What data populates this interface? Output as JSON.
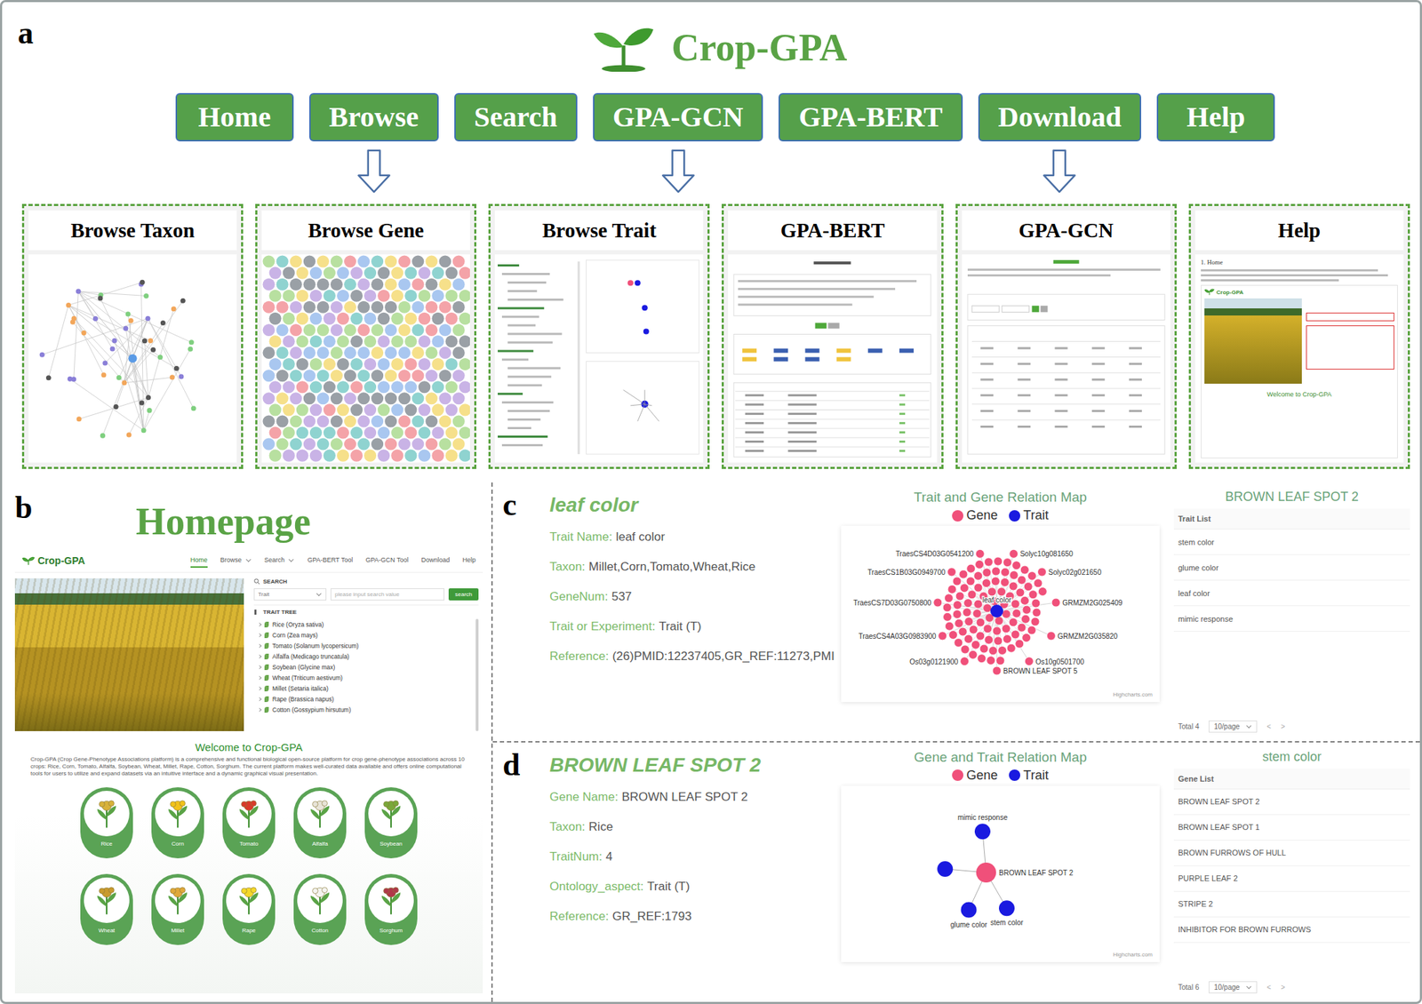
{
  "a": {
    "label": "a",
    "logo": "Crop-GPA",
    "nav": [
      {
        "label": "Home",
        "arrow": false
      },
      {
        "label": "Browse",
        "arrow": true
      },
      {
        "label": "Search",
        "arrow": false
      },
      {
        "label": "GPA-GCN",
        "arrow": true
      },
      {
        "label": "GPA-BERT",
        "arrow": false
      },
      {
        "label": "Download",
        "arrow": true
      },
      {
        "label": "Help",
        "arrow": false
      }
    ],
    "cards": [
      {
        "title": "Browse Taxon",
        "kind": "taxon"
      },
      {
        "title": "Browse Gene",
        "kind": "gene"
      },
      {
        "title": "Browse Trait",
        "kind": "trait"
      },
      {
        "title": "GPA-BERT",
        "kind": "bert"
      },
      {
        "title": "GPA-GCN",
        "kind": "gcn"
      },
      {
        "title": "Help",
        "kind": "help",
        "heading": "1. Home",
        "logo": "Crop-GPA",
        "welcome": "Welcome to Crop-GPA"
      }
    ]
  },
  "b": {
    "label": "b",
    "title": "Homepage",
    "logo": "Crop-GPA",
    "menu": [
      {
        "label": "Home",
        "selected": true,
        "dropdown": false
      },
      {
        "label": "Browse",
        "selected": false,
        "dropdown": true
      },
      {
        "label": "Search",
        "selected": false,
        "dropdown": true
      },
      {
        "label": "GPA-BERT Tool",
        "selected": false,
        "dropdown": false
      },
      {
        "label": "GPA-GCN Tool",
        "selected": false,
        "dropdown": false
      },
      {
        "label": "Download",
        "selected": false,
        "dropdown": false
      },
      {
        "label": "Help",
        "selected": false,
        "dropdown": false
      }
    ],
    "search": {
      "heading": "SEARCH",
      "select": "Trait",
      "placeholder": "please input search value",
      "button": "search"
    },
    "tree": {
      "heading": "TRAIT TREE",
      "items": [
        "Rice (Oryza sativa)",
        "Corn (Zea mays)",
        "Tomato (Solanum lycopersicum)",
        "Alfalfa (Medicago truncatula)",
        "Soybean (Glycine max)",
        "Wheat (Triticum aestivum)",
        "Millet (Setaria italica)",
        "Rape (Brassica napus)",
        "Cotton (Gossypium hirsutum)"
      ]
    },
    "welcome": "Welcome to Crop-GPA",
    "intro": "Crop-GPA (Crop Gene-Phenotype Associations platform) is a comprehensive and functional biological open-source platform for crop gene-phenotype associations across 10 crops: Rice, Corn, Tomato, Alfalfa, Soybean, Wheat, Millet, Rape, Cotton, Sorghum. The current platform makes well-curated data available and offers online computational tools for users to utilize and expand datasets via an intuitive interface and a dynamic graphical visual presentation.",
    "crops": [
      {
        "name": "Rice",
        "color": "#d8b23a"
      },
      {
        "name": "Corn",
        "color": "#f2c21b"
      },
      {
        "name": "Tomato",
        "color": "#d93a2b"
      },
      {
        "name": "Alfalfa",
        "color": "#e8e4d8"
      },
      {
        "name": "Soybean",
        "color": "#7aa83a"
      },
      {
        "name": "Wheat",
        "color": "#c99a2e"
      },
      {
        "name": "Millet",
        "color": "#e0a83a"
      },
      {
        "name": "Rape",
        "color": "#f5d82a"
      },
      {
        "name": "Cotton",
        "color": "#f4f4f0"
      },
      {
        "name": "Sorghum",
        "color": "#b0384a"
      }
    ]
  },
  "c": {
    "label": "c",
    "title": "leaf color",
    "fields": [
      {
        "key": "Trait Name:",
        "value": "leaf color"
      },
      {
        "key": "Taxon:",
        "value": "Millet,Corn,Tomato,Wheat,Rice"
      },
      {
        "key": "GeneNum:",
        "value": "537"
      },
      {
        "key": "Trait or Experiment:",
        "value": "Trait (T)"
      },
      {
        "key": "Reference:",
        "value": "(26)PMID:12237405,GR_REF:11273,PMI"
      }
    ],
    "map": {
      "title": "Trait and Gene Relation Map",
      "legend": [
        {
          "label": "Gene",
          "color": "#f0507a"
        },
        {
          "label": "Trait",
          "color": "#1a1ae0"
        }
      ],
      "center": "leaf color",
      "genes": [
        "Solyc10g081650",
        "Solyc02g021650",
        "GRMZM2G025409",
        "GRMZM2G035820",
        "Os10g0501700",
        "BROWN LEAF SPOT 5",
        "Os03g0121900",
        "TraesCS4A03G0983900",
        "TraesCS7D03G0750800",
        "TraesCS1B03G0949700",
        "TraesCS4D03G0541200"
      ],
      "extra_gene_nodes": 90,
      "credit": "Highcharts.com"
    },
    "list": {
      "title": "BROWN LEAF SPOT 2",
      "heading": "Trait List",
      "items": [
        "stem color",
        "glume color",
        "leaf color",
        "mimic response"
      ],
      "total": "Total 4",
      "page_size": "10/page",
      "prev": "<",
      "next": ">"
    }
  },
  "d": {
    "label": "d",
    "title": "BROWN LEAF SPOT 2",
    "fields": [
      {
        "key": "Gene Name:",
        "value": "BROWN LEAF SPOT 2"
      },
      {
        "key": "Taxon:",
        "value": "Rice"
      },
      {
        "key": "TraitNum:",
        "value": "4"
      },
      {
        "key": "Ontology_aspect:",
        "value": "Trait (T)"
      },
      {
        "key": "Reference:",
        "value": "GR_REF:1793"
      }
    ],
    "map": {
      "title": "Gene and Trait Relation Map",
      "legend": [
        {
          "label": "Gene",
          "color": "#f0507a"
        },
        {
          "label": "Trait",
          "color": "#1a1ae0"
        }
      ],
      "center": "BROWN LEAF SPOT 2",
      "traits": [
        "mimic response",
        "",
        "glume color",
        "stem color"
      ],
      "credit": "Highcharts.com"
    },
    "list": {
      "title": "stem color",
      "heading": "Gene List",
      "items": [
        "BROWN LEAF SPOT 2",
        "BROWN LEAF SPOT 1",
        "BROWN FURROWS OF HULL",
        "PURPLE LEAF 2",
        "STRIPE 2",
        "INHIBITOR FOR BROWN FURROWS"
      ],
      "total": "Total 6",
      "page_size": "10/page",
      "prev": "<",
      "next": ">"
    }
  }
}
